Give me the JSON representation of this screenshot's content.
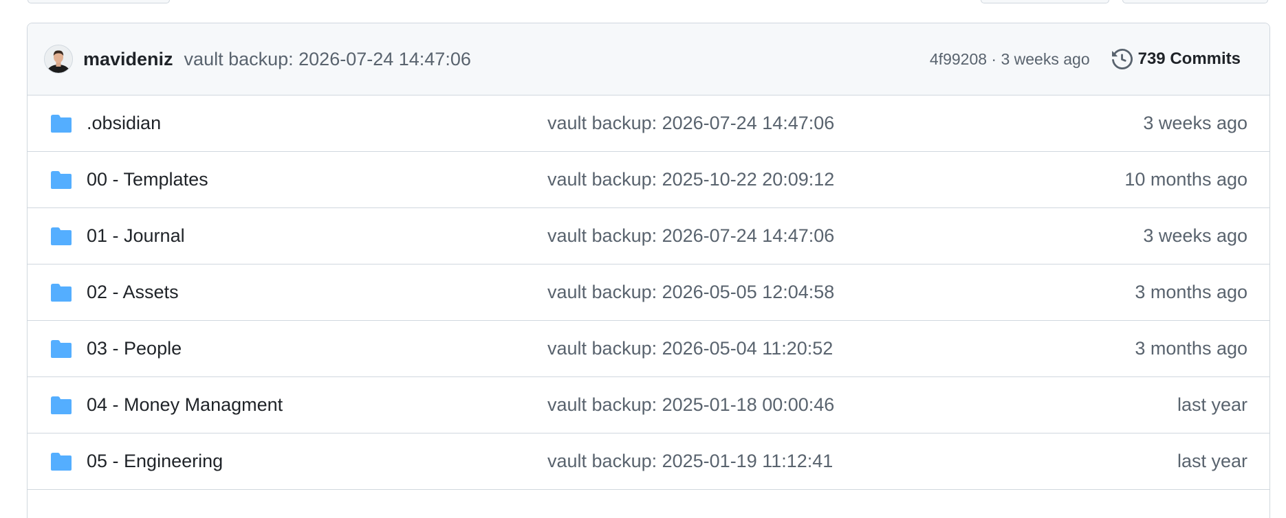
{
  "latest_commit": {
    "author": "mavideniz",
    "message": "vault backup: 2026-07-24 14:47:06",
    "meta": "4f99208 · 3 weeks ago",
    "commits_label": "739 Commits"
  },
  "icons": {
    "folder": "folder-icon",
    "history": "history-icon",
    "avatar": "avatar"
  },
  "colors": {
    "folder": "#54aeff",
    "header_bg": "#f6f8fa",
    "border": "#d0d7de",
    "muted_text": "#59636e"
  },
  "files": [
    {
      "name": ".obsidian",
      "message": "vault backup: 2026-07-24 14:47:06",
      "age": "3 weeks ago"
    },
    {
      "name": "00 - Templates",
      "message": "vault backup: 2025-10-22 20:09:12",
      "age": "10 months ago"
    },
    {
      "name": "01 - Journal",
      "message": "vault backup: 2026-07-24 14:47:06",
      "age": "3 weeks ago"
    },
    {
      "name": "02 - Assets",
      "message": "vault backup: 2026-05-05 12:04:58",
      "age": "3 months ago"
    },
    {
      "name": "03 - People",
      "message": "vault backup: 2026-05-04 11:20:52",
      "age": "3 months ago"
    },
    {
      "name": "04 - Money Managment",
      "message": "vault backup: 2025-01-18 00:00:46",
      "age": "last year"
    },
    {
      "name": "05 - Engineering",
      "message": "vault backup: 2025-01-19 11:12:41",
      "age": "last year"
    }
  ]
}
